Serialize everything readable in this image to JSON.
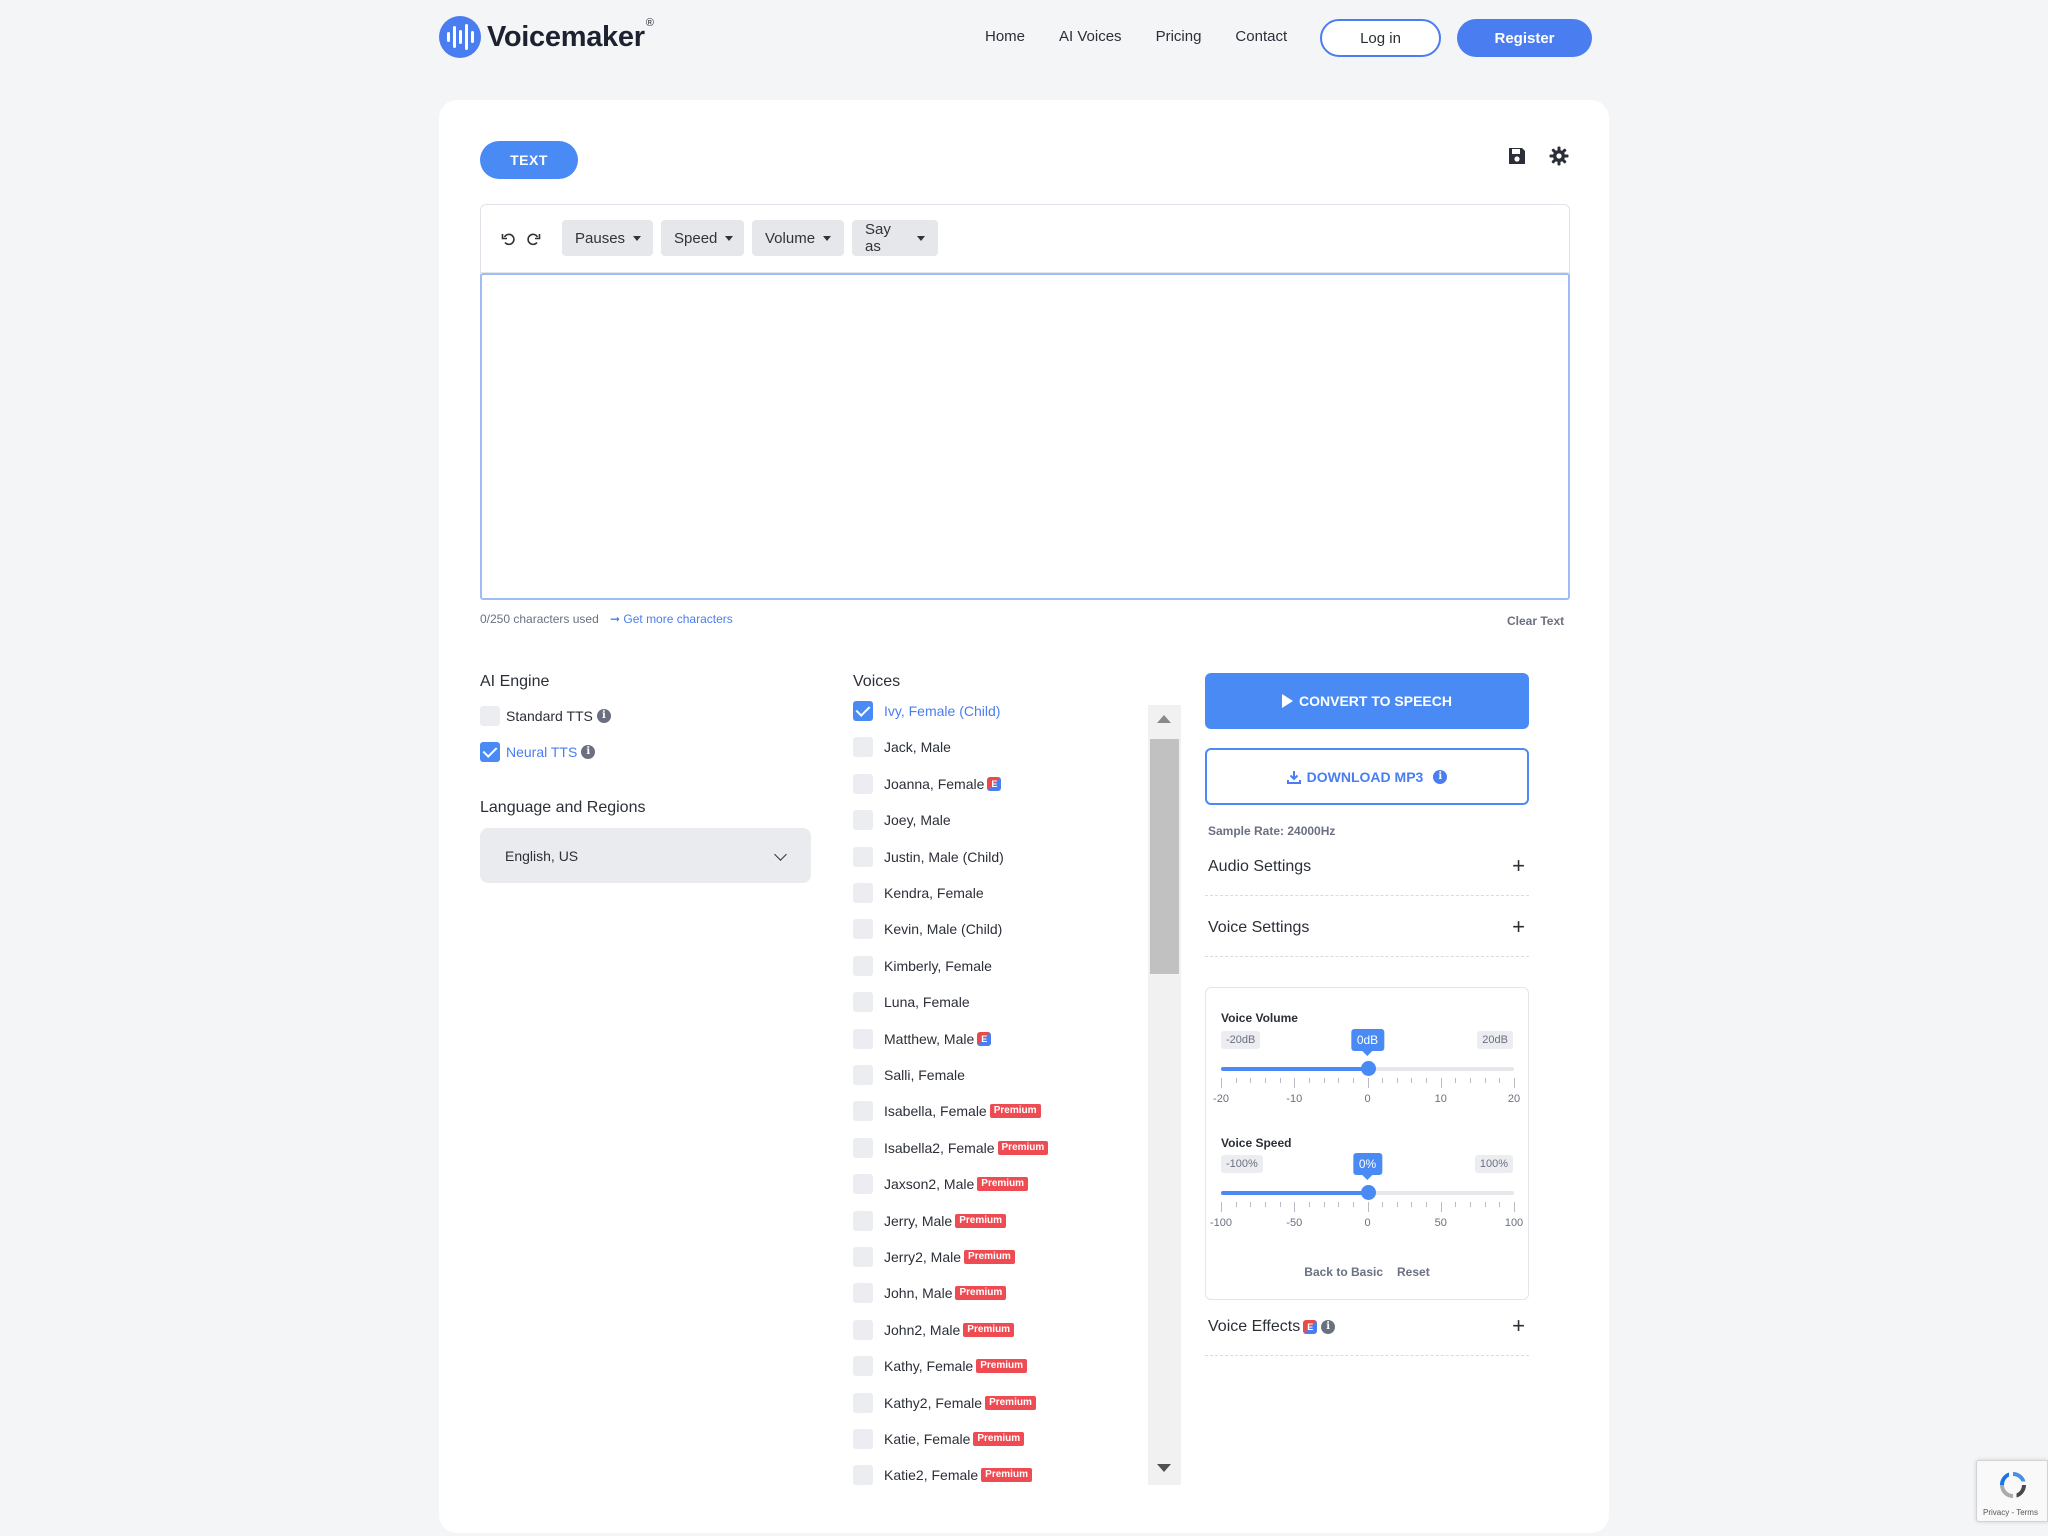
{
  "brand": {
    "name": "Voicemaker",
    "reg": "®",
    "accent": "#4a7df0"
  },
  "nav": {
    "items": [
      "Home",
      "AI Voices",
      "Pricing",
      "Contact"
    ],
    "login": "Log in",
    "register": "Register"
  },
  "editor": {
    "tab": "TEXT",
    "toolbar": {
      "pauses": "Pauses",
      "speed": "Speed",
      "volume": "Volume",
      "say_as": "Say as"
    },
    "text_value": "",
    "char_count": "0/250 characters used",
    "get_more": "➞ Get more characters",
    "clear": "Clear Text"
  },
  "engine": {
    "title": "AI Engine",
    "options": [
      {
        "label": "Standard TTS",
        "checked": false
      },
      {
        "label": "Neural TTS",
        "checked": true
      }
    ]
  },
  "language": {
    "title": "Language and Regions",
    "selected": "English, US"
  },
  "voices": {
    "title": "Voices",
    "items": [
      {
        "name": "Ivy, Female (Child)",
        "checked": true,
        "badge": ""
      },
      {
        "name": "Jack, Male",
        "checked": false,
        "badge": ""
      },
      {
        "name": "Joanna, Female",
        "checked": false,
        "badge": "E"
      },
      {
        "name": "Joey, Male",
        "checked": false,
        "badge": ""
      },
      {
        "name": "Justin, Male (Child)",
        "checked": false,
        "badge": ""
      },
      {
        "name": "Kendra, Female",
        "checked": false,
        "badge": ""
      },
      {
        "name": "Kevin, Male (Child)",
        "checked": false,
        "badge": ""
      },
      {
        "name": "Kimberly, Female",
        "checked": false,
        "badge": ""
      },
      {
        "name": "Luna, Female",
        "checked": false,
        "badge": ""
      },
      {
        "name": "Matthew, Male",
        "checked": false,
        "badge": "E"
      },
      {
        "name": "Salli, Female",
        "checked": false,
        "badge": ""
      },
      {
        "name": "Isabella, Female",
        "checked": false,
        "badge": "Premium"
      },
      {
        "name": "Isabella2, Female",
        "checked": false,
        "badge": "Premium"
      },
      {
        "name": "Jaxson2, Male",
        "checked": false,
        "badge": "Premium"
      },
      {
        "name": "Jerry, Male",
        "checked": false,
        "badge": "Premium"
      },
      {
        "name": "Jerry2, Male",
        "checked": false,
        "badge": "Premium"
      },
      {
        "name": "John, Male",
        "checked": false,
        "badge": "Premium"
      },
      {
        "name": "John2, Male",
        "checked": false,
        "badge": "Premium"
      },
      {
        "name": "Kathy, Female",
        "checked": false,
        "badge": "Premium"
      },
      {
        "name": "Kathy2, Female",
        "checked": false,
        "badge": "Premium"
      },
      {
        "name": "Katie, Female",
        "checked": false,
        "badge": "Premium"
      },
      {
        "name": "Katie2, Female",
        "checked": false,
        "badge": "Premium"
      }
    ]
  },
  "actions": {
    "convert": "CONVERT TO SPEECH",
    "download": "DOWNLOAD MP3",
    "sample_rate": "Sample Rate: 24000Hz"
  },
  "sections": {
    "audio": "Audio Settings",
    "voice": "Voice Settings",
    "effects": "Voice Effects",
    "effects_badge": "E"
  },
  "voice_settings": {
    "volume": {
      "label": "Voice Volume",
      "min_label": "-20dB",
      "max_label": "20dB",
      "current": "0dB",
      "level_percent": 50,
      "ticks": [
        "-20",
        "-10",
        "0",
        "10",
        "20"
      ]
    },
    "speed": {
      "label": "Voice Speed",
      "min_label": "-100%",
      "max_label": "100%",
      "current": "0%",
      "level_percent": 50,
      "ticks": [
        "-100",
        "-50",
        "0",
        "50",
        "100"
      ]
    },
    "back": "Back to Basic",
    "reset": "Reset"
  },
  "recaptcha": {
    "text": "Privacy - Terms"
  }
}
